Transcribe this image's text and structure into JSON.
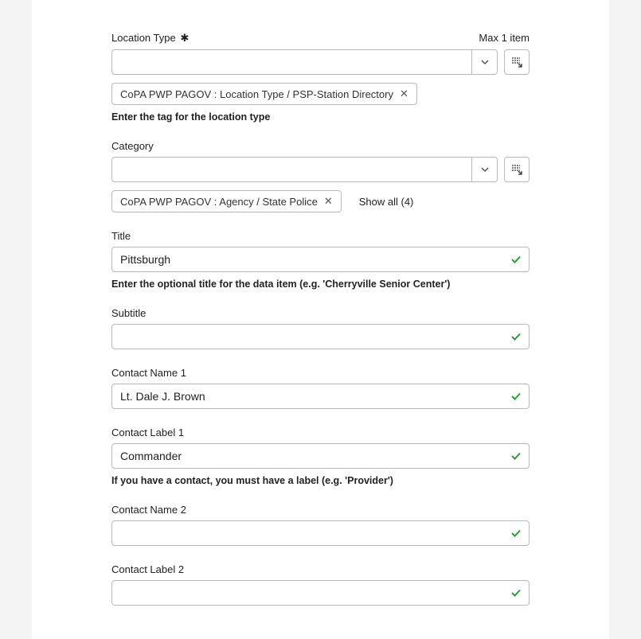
{
  "locationType": {
    "label": "Location Type",
    "maxItemsLabel": "Max 1 item",
    "tag": "CoPA PWP PAGOV : Location Type / PSP-Station Directory",
    "helpText": "Enter the tag for the location type"
  },
  "category": {
    "label": "Category",
    "tag": "CoPA PWP PAGOV : Agency / State Police",
    "showAllLabel": "Show all (4)"
  },
  "title": {
    "label": "Title",
    "value": "Pittsburgh",
    "helpText": "Enter the optional title for the data item (e.g. 'Cherryville Senior Center')"
  },
  "subtitle": {
    "label": "Subtitle",
    "value": ""
  },
  "contactName1": {
    "label": "Contact Name 1",
    "value": "Lt. Dale J. Brown"
  },
  "contactLabel1": {
    "label": "Contact Label 1",
    "value": "Commander",
    "helpText": "If you have a contact, you must have a label (e.g. 'Provider')"
  },
  "contactName2": {
    "label": "Contact Name 2",
    "value": ""
  },
  "contactLabel2": {
    "label": "Contact Label 2",
    "value": ""
  }
}
